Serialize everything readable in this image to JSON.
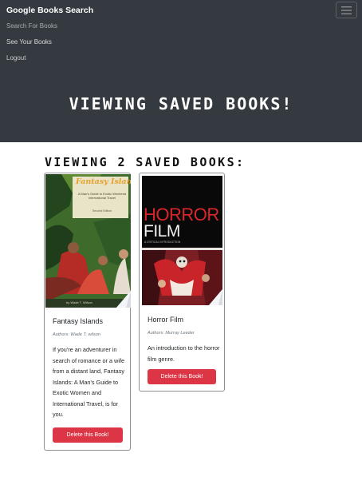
{
  "navbar": {
    "brand": "Google Books Search",
    "links": [
      "Search For Books",
      "See Your Books",
      "Logout"
    ],
    "background": "#343a40"
  },
  "hero": {
    "title": "VIEWING SAVED BOOKS!"
  },
  "saved": {
    "heading": "VIEWING 2 SAVED BOOKS:",
    "books": [
      {
        "title": "Fantasy Islands",
        "authors": "Authors: Wade T. wilson",
        "cover_text": {
          "title": "Fantasy Islands",
          "subtitle": "A Man's Guide to Exotic Weekend International Travel",
          "edition": "Second Edition",
          "author": "by Wade T. Wilson"
        },
        "description": "If you're an adventurer in search of romance or a wife from a distant land, Fantasy Islands: A Man's Guide to Exotic Women and International Travel, is for you.",
        "delete_label": "Delete this Book!"
      },
      {
        "title": "Horror Film",
        "authors": "Authors: Murray Leeder",
        "cover_text": {
          "title_line1": "HORROR",
          "title_line2": "FILM",
          "subtitle": "A CRITICAL INTRODUCTION"
        },
        "description": "An introduction to the horror film genre.",
        "delete_label": "Delete this Book!"
      }
    ]
  },
  "colors": {
    "danger": "#dc3545",
    "card_border": "#8e9194"
  }
}
